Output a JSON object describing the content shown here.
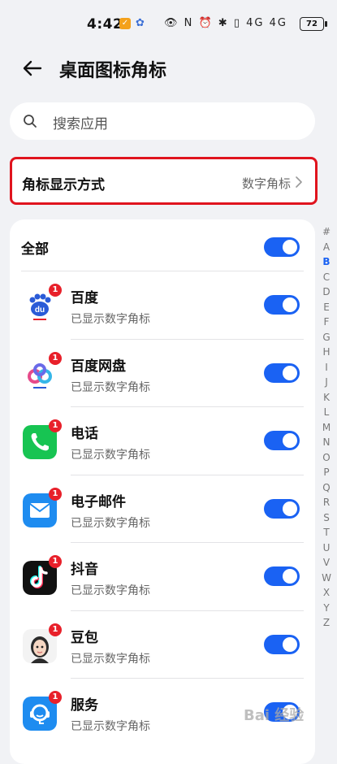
{
  "status_bar": {
    "time": "4:42",
    "battery": "72",
    "icons_text": "👁 N ⏰ ✱ ▯ 4G 4G"
  },
  "header": {
    "title": "桌面图标角标"
  },
  "search": {
    "placeholder": "搜索应用"
  },
  "badge_mode": {
    "label": "角标显示方式",
    "value": "数字角标"
  },
  "all_toggle": {
    "label": "全部",
    "on": true
  },
  "apps": [
    {
      "name": "百度",
      "status": "已显示数字角标",
      "badge": "1",
      "icon": "baidu-icon",
      "on": true
    },
    {
      "name": "百度网盘",
      "status": "已显示数字角标",
      "badge": "1",
      "icon": "baidu-netdisk-icon",
      "on": true
    },
    {
      "name": "电话",
      "status": "已显示数字角标",
      "badge": "1",
      "icon": "phone-icon",
      "on": true
    },
    {
      "name": "电子邮件",
      "status": "已显示数字角标",
      "badge": "1",
      "icon": "email-icon",
      "on": true
    },
    {
      "name": "抖音",
      "status": "已显示数字角标",
      "badge": "1",
      "icon": "douyin-icon",
      "on": true
    },
    {
      "name": "豆包",
      "status": "已显示数字角标",
      "badge": "1",
      "icon": "doubao-icon",
      "on": true
    },
    {
      "name": "服务",
      "status": "已显示数字角标",
      "badge": "1",
      "icon": "service-icon",
      "on": true
    }
  ],
  "alpha_index": [
    "#",
    "A",
    "B",
    "C",
    "D",
    "E",
    "F",
    "G",
    "H",
    "I",
    "J",
    "K",
    "L",
    "M",
    "N",
    "O",
    "P",
    "Q",
    "R",
    "S",
    "T",
    "U",
    "V",
    "W",
    "X",
    "Y",
    "Z"
  ],
  "alpha_active": "B",
  "watermark": "Bai 经验",
  "colors": {
    "accent": "#1a62f3",
    "highlight_border": "#e0141e",
    "badge": "#e8202a"
  }
}
